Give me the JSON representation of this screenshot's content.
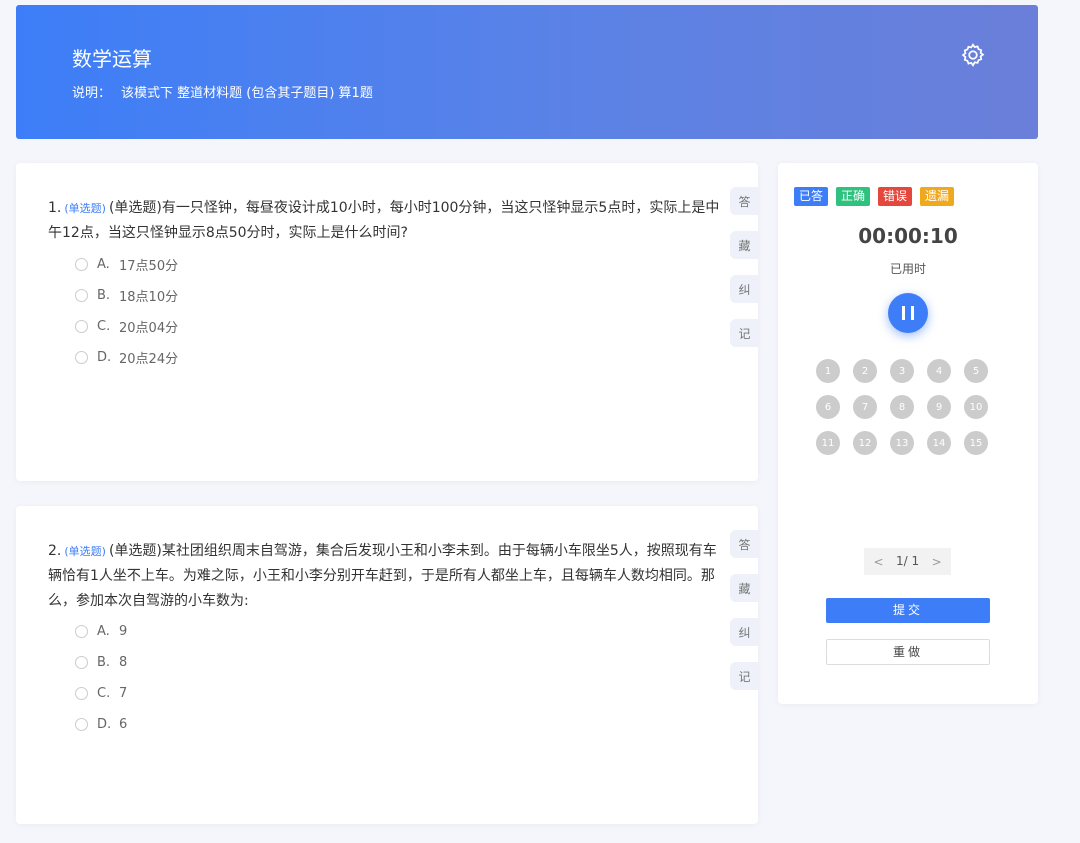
{
  "header": {
    "title": "数学运算",
    "desc_label": "说明：",
    "desc_text": "该模式下 整道材料题 (包含其子题目) 算1题"
  },
  "questions": [
    {
      "number": "1.",
      "tag": "(单选题)",
      "text": "(单选题)有一只怪钟，每昼夜设计成10小时，每小时100分钟，当这只怪钟显示5点时，实际上是中午12点，当这只怪钟显示8点50分时，实际上是什么时间?",
      "options": [
        {
          "letter": "A.",
          "text": "17点50分"
        },
        {
          "letter": "B.",
          "text": "18点10分"
        },
        {
          "letter": "C.",
          "text": "20点04分"
        },
        {
          "letter": "D.",
          "text": "20点24分"
        }
      ]
    },
    {
      "number": "2.",
      "tag": "(单选题)",
      "text": "(单选题)某社团组织周末自驾游，集合后发现小王和小李未到。由于每辆小车限坐5人，按照现有车辆恰有1人坐不上车。为难之际，小王和小李分别开车赶到，于是所有人都坐上车，且每辆车人数均相同。那么，参加本次自驾游的小车数为:",
      "options": [
        {
          "letter": "A.",
          "text": "9"
        },
        {
          "letter": "B.",
          "text": "8"
        },
        {
          "letter": "C.",
          "text": "7"
        },
        {
          "letter": "D.",
          "text": "6"
        }
      ]
    }
  ],
  "side_buttons": [
    "答",
    "藏",
    "纠",
    "记"
  ],
  "legend": [
    {
      "label": "已答",
      "color": "#3d7ef8"
    },
    {
      "label": "正确",
      "color": "#2ec27e"
    },
    {
      "label": "错误",
      "color": "#e5473d"
    },
    {
      "label": "遗漏",
      "color": "#f0a81c"
    }
  ],
  "timer": {
    "value": "00:00:10",
    "label": "已用时"
  },
  "answer_sheet": [
    "1",
    "2",
    "3",
    "4",
    "5",
    "6",
    "7",
    "8",
    "9",
    "10",
    "11",
    "12",
    "13",
    "14",
    "15"
  ],
  "pager": {
    "prev": "<",
    "text": "1/ 1",
    "next": ">"
  },
  "actions": {
    "submit": "提交",
    "redo": "重做"
  },
  "colors": {
    "accent": "#3d7ef8",
    "number_bg": "#cccccc"
  }
}
